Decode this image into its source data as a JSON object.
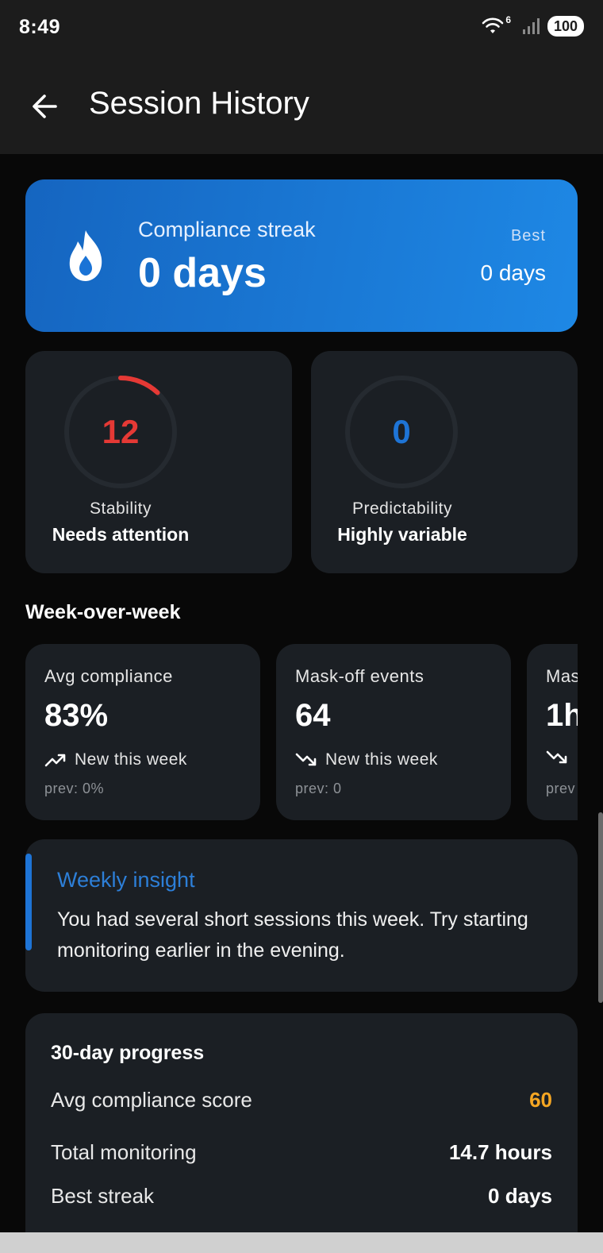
{
  "status_bar": {
    "time": "8:49",
    "wifi_badge": "6",
    "battery": "100"
  },
  "app_bar": {
    "title": "Session History",
    "back_icon": "arrow-left-icon"
  },
  "streak": {
    "icon": "flame-drop-icon",
    "label": "Compliance streak",
    "value": "0 days",
    "best_label": "Best",
    "best_value": "0 days",
    "gradient_start": "#1565c0",
    "gradient_end": "#1e88e5"
  },
  "gauges": [
    {
      "value": "12",
      "name": "Stability",
      "status": "Needs attention",
      "color": "#e53935",
      "fraction": 0.12
    },
    {
      "value": "0",
      "name": "Predictability",
      "status": "Highly variable",
      "color": "#1e74d6",
      "fraction": 0
    }
  ],
  "week_over_week": {
    "title": "Week-over-week",
    "cards": [
      {
        "label": "Avg compliance",
        "value": "83%",
        "trend_icon": "trending-up-icon",
        "trend": "New this week",
        "prev": "prev: 0%"
      },
      {
        "label": "Mask-off events",
        "value": "64",
        "trend_icon": "trending-down-icon",
        "trend": "New this week",
        "prev": "prev: 0"
      },
      {
        "label": "Mas",
        "value": "1h",
        "trend_icon": "trending-down-icon",
        "trend": "",
        "prev": "prev"
      }
    ]
  },
  "insight": {
    "title": "Weekly insight",
    "text": "You had several short sessions this week. Try starting monitoring earlier in the evening.",
    "accent": "#1e74d6"
  },
  "progress": {
    "title": "30-day progress",
    "rows": [
      {
        "label": "Avg compliance score",
        "value": "60",
        "color": "#f5a623"
      },
      {
        "label": "Total monitoring",
        "value": "14.7 hours",
        "color": "#ffffff"
      },
      {
        "label": "Best streak",
        "value": "0 days",
        "color": "#ffffff"
      }
    ]
  }
}
